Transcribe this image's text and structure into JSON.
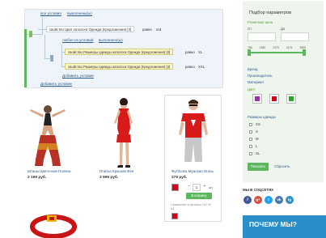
{
  "condition_builder": {
    "top_links": [
      "все условия",
      "выполнены(ы)"
    ],
    "row1": {
      "tag": "",
      "property": "свойство Цвет каталога Одежда (предложения) [3]",
      "operator": "равно",
      "value": "red"
    },
    "group_links": [
      "любое из условий",
      "выполнено(ы)"
    ],
    "group_tag": "",
    "row2": {
      "property": "свойство Размеры одежды каталога Одежда (предложения) [3]",
      "operator": "равно",
      "value": "XL"
    },
    "row3": {
      "property": "свойство Размеры одежды каталога Одежда (предложения) [3]",
      "operator": "равно",
      "value": "XXL"
    },
    "add_inner": "Добавить условие",
    "add_outer": "Добавить условие"
  },
  "products": [
    {
      "name": "Штаны Цветочная Поляна",
      "price": "2 199 руб."
    },
    {
      "name": "Платье Красная Фея",
      "price": "3 999 руб."
    },
    {
      "name": "Футболка Мужская Огонь",
      "price": "279 руб.",
      "qty_minus": "−",
      "qty_value": "1",
      "qty_plus": "+",
      "qty_unit": "шт",
      "buy_label": "В корзину",
      "compare_label": "Сравнение и Артикул 137 М 43"
    }
  ],
  "filter": {
    "title": "Подбор параметров",
    "price_label": "Розничная цена",
    "from_label": "От",
    "to_label": "До",
    "scale": [
      "786",
      "1582",
      "2379",
      "3175",
      "3999"
    ],
    "price_fill": 1.0,
    "links": [
      "Бренд",
      "Производитель",
      "Материал"
    ],
    "color_label": "Цвет",
    "colors": [
      "#9b2fae",
      "#d9001b",
      "#2aa52a"
    ],
    "size_label": "Размеры одежды",
    "sizes": [
      "XS",
      "S",
      "M",
      "L",
      "XL"
    ],
    "show_button": "Показать",
    "reset_link": "Сбросить"
  },
  "social": {
    "title": "МЫ В СОЦСЕТЯХ",
    "icons": [
      {
        "name": "facebook-icon",
        "glyph": "f",
        "color": "#3b5998"
      },
      {
        "name": "google-plus-icon",
        "glyph": "g+",
        "color": "#dd4b39"
      },
      {
        "name": "twitter-icon",
        "glyph": "t",
        "color": "#1da1f2"
      },
      {
        "name": "vk-icon",
        "glyph": "vk",
        "color": "#4a76a8"
      },
      {
        "name": "instagram-icon",
        "glyph": "ig",
        "color": "#2c8fc6"
      }
    ]
  },
  "why": {
    "title": "ПОЧЕМУ МЫ?"
  }
}
